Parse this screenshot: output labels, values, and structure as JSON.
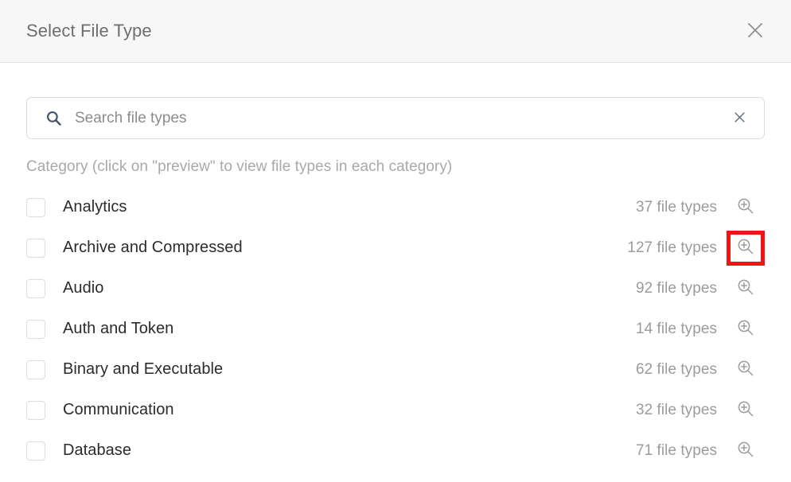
{
  "header": {
    "title": "Select File Type",
    "close_label": "close-icon"
  },
  "search": {
    "placeholder": "Search file types",
    "value": "",
    "icon": "search-icon",
    "clear_icon": "close-icon"
  },
  "hint": "Category (click on \"preview\" to view file types in each category)",
  "preview_icon": "zoom-in-icon",
  "highlight_color": "#f01414",
  "categories": [
    {
      "label": "Analytics",
      "count": "37 file types",
      "checked": false,
      "highlighted": false
    },
    {
      "label": "Archive and Compressed",
      "count": "127 file types",
      "checked": false,
      "highlighted": true
    },
    {
      "label": "Audio",
      "count": "92 file types",
      "checked": false,
      "highlighted": false
    },
    {
      "label": "Auth and Token",
      "count": "14 file types",
      "checked": false,
      "highlighted": false
    },
    {
      "label": "Binary and Executable",
      "count": "62 file types",
      "checked": false,
      "highlighted": false
    },
    {
      "label": "Communication",
      "count": "32 file types",
      "checked": false,
      "highlighted": false
    },
    {
      "label": "Database",
      "count": "71 file types",
      "checked": false,
      "highlighted": false
    }
  ]
}
